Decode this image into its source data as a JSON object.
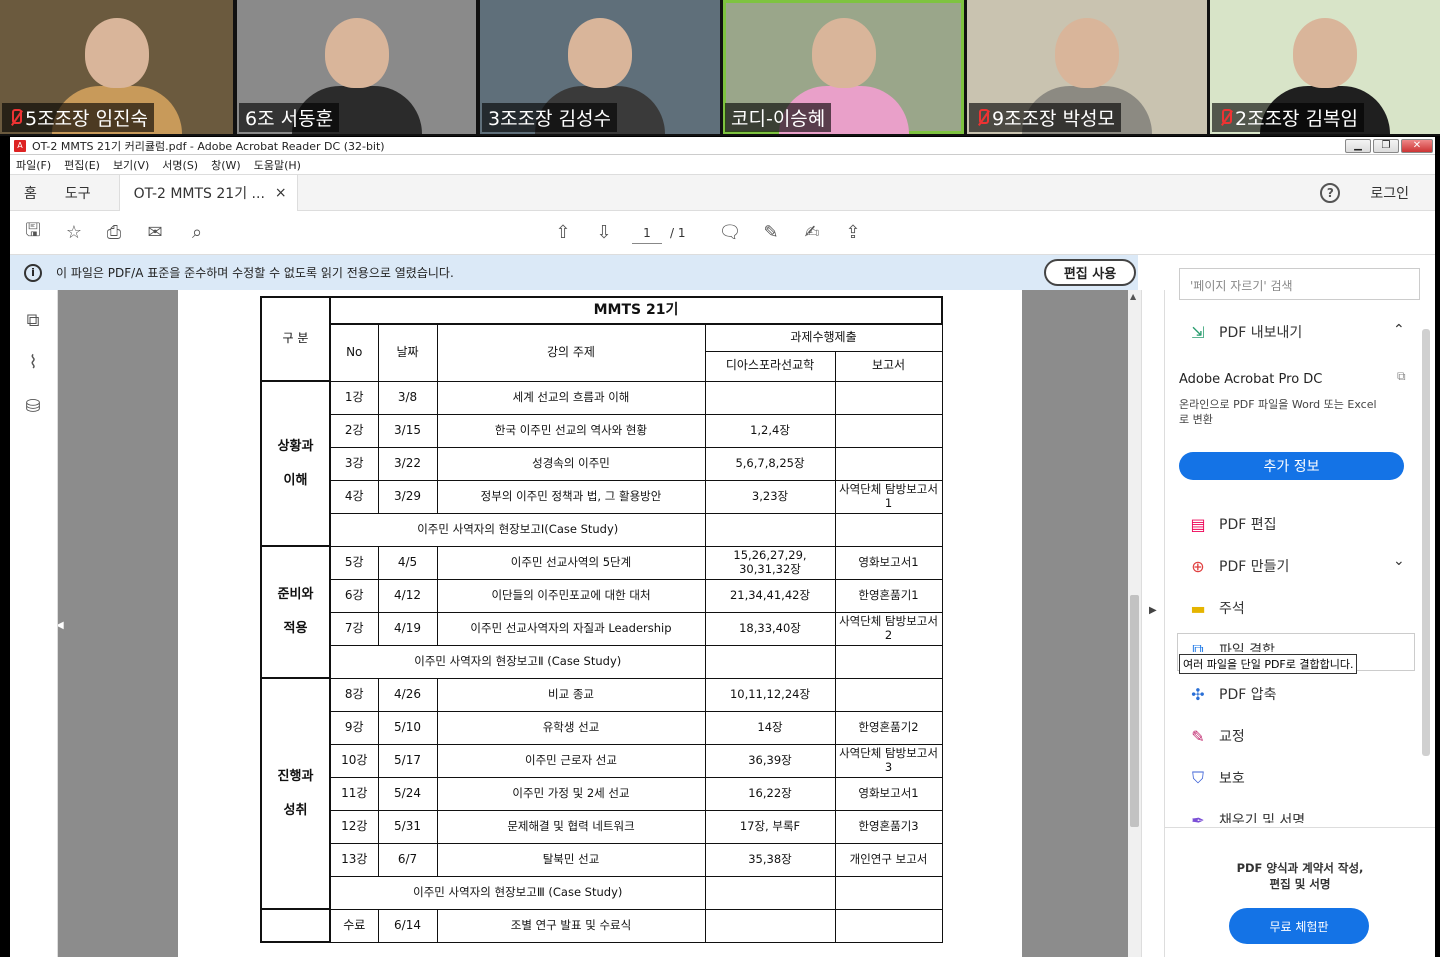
{
  "participants": [
    {
      "name": "5조조장 임진숙",
      "muted": true,
      "bg": "#6b5a3e",
      "shirt": "#c89a5a"
    },
    {
      "name": "6조 서동훈",
      "muted": false,
      "bg": "#8a8a8a",
      "shirt": "#2b2b2b"
    },
    {
      "name": "3조조장 김성수",
      "muted": false,
      "bg": "#5f6f7a",
      "shirt": "#3a3a3a"
    },
    {
      "name": "코디-이승혜",
      "muted": false,
      "bg": "#9aa68a",
      "shirt": "#e9a0c9"
    },
    {
      "name": "9조조장 박성모",
      "muted": true,
      "bg": "#c9c3b0",
      "shirt": "#8c8a82"
    },
    {
      "name": "2조조장 김복임",
      "muted": true,
      "bg": "#d8e4c8",
      "shirt": "#1f1f1f"
    }
  ],
  "window": {
    "title": "OT-2 MMTS 21기 커리큘럼.pdf - Adobe Acrobat Reader DC (32-bit)",
    "menus": [
      "파일(F)",
      "편집(E)",
      "보기(V)",
      "서명(S)",
      "창(W)",
      "도움말(H)"
    ],
    "tabs": {
      "home": "홈",
      "tools": "도구",
      "doc": "OT-2 MMTS 21기 ...",
      "close": "×",
      "login": "로그인"
    },
    "page": {
      "current": "1",
      "total": "/ 1"
    },
    "info_message": "이 파일은 PDF/A 표준을 준수하며 수정할 수 없도록 읽기 전용으로 열렸습니다.",
    "edit_button": "편집 사용"
  },
  "table": {
    "title": "MMTS 21기",
    "headers": {
      "category": "구 분",
      "no": "No",
      "date": "날짜",
      "topic": "강의 주제",
      "assign": "과제수행제출",
      "diaspora": "디아스포라선교학",
      "report": "보고서"
    },
    "groups": [
      {
        "name1": "상황과",
        "name2": "이해",
        "rows": [
          {
            "no": "1강",
            "date": "3/8",
            "topic": "세계 선교의 흐름과 이해",
            "diaspora": "",
            "report": ""
          },
          {
            "no": "2강",
            "date": "3/15",
            "topic": "한국 이주민 선교의 역사와 현황",
            "diaspora": "1,2,4장",
            "report": ""
          },
          {
            "no": "3강",
            "date": "3/22",
            "topic": "성경속의 이주민",
            "diaspora": "5,6,7,8,25장",
            "report": ""
          },
          {
            "no": "4강",
            "date": "3/29",
            "topic": "정부의 이주민 정책과 법, 그 활용방안",
            "diaspora": "3,23장",
            "report": "사역단체 탐방보고서1"
          }
        ],
        "study": "이주민 사역자의 현장보고Ⅰ(Case Study)"
      },
      {
        "name1": "준비와",
        "name2": "적용",
        "rows": [
          {
            "no": "5강",
            "date": "4/5",
            "topic": "이주민 선교사역의 5단계",
            "diaspora": "15,26,27,29, 30,31,32장",
            "report": "영화보고서1"
          },
          {
            "no": "6강",
            "date": "4/12",
            "topic": "이단들의 이주민포교에 대한 대처",
            "diaspora": "21,34,41,42장",
            "report": "한영혼품기1"
          },
          {
            "no": "7강",
            "date": "4/19",
            "topic": "이주민 선교사역자의 자질과 Leadership",
            "diaspora": "18,33,40장",
            "report": "사역단체 탐방보고서2"
          }
        ],
        "study": "이주민 사역자의 현장보고Ⅱ (Case Study)"
      },
      {
        "name1": "진행과",
        "name2": "성취",
        "rows": [
          {
            "no": "8강",
            "date": "4/26",
            "topic": "비교 종교",
            "diaspora": "10,11,12,24장",
            "report": ""
          },
          {
            "no": "9강",
            "date": "5/10",
            "topic": "유학생 선교",
            "diaspora": "14장",
            "report": "한영혼품기2"
          },
          {
            "no": "10강",
            "date": "5/17",
            "topic": "이주민 근로자 선교",
            "diaspora": "36,39장",
            "report": "사역단체 탐방보고서3"
          },
          {
            "no": "11강",
            "date": "5/24",
            "topic": "이주민 가정 및 2세 선교",
            "diaspora": "16,22장",
            "report": "영화보고서1"
          },
          {
            "no": "12강",
            "date": "5/31",
            "topic": "문제해결 및 협력 네트워크",
            "diaspora": "17장, 부록F",
            "report": "한영혼품기3"
          },
          {
            "no": "13강",
            "date": "6/7",
            "topic": "탈북민 선교",
            "diaspora": "35,38장",
            "report": "개인연구 보고서"
          }
        ],
        "study": "이주민 사역자의 현장보고Ⅲ (Case Study)"
      }
    ],
    "final": {
      "no": "수료",
      "date": "6/14",
      "topic": "조별 연구 발표 및 수료식"
    }
  },
  "right_panel": {
    "search_placeholder": "'페이지 자르기' 검색",
    "export": "PDF 내보내기",
    "pro_title": "Adobe Acrobat Pro DC",
    "pro_desc": "온라인으로 PDF 파일을 Word 또는 Excel로 변환",
    "more_info": "추가 정보",
    "tools": [
      "PDF 편집",
      "PDF 만들기",
      "주석",
      "파일 결합",
      "PDF 압축",
      "교정",
      "보호",
      "채우기 및 서명"
    ],
    "tooltip": "여러 파일을 단일 PDF로 결합합니다.",
    "promo_line1": "PDF 양식과 계약서 작성,",
    "promo_line2": "편집 및 서명",
    "trial": "무료 체험판"
  }
}
